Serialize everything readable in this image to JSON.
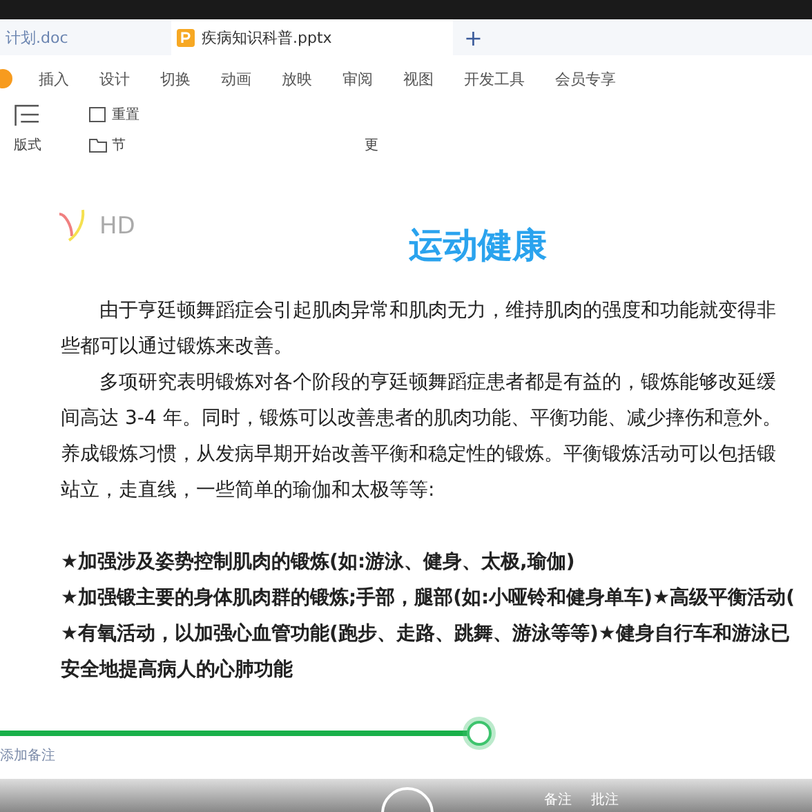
{
  "tabs": [
    {
      "label": "计划.doc",
      "kind": "doc",
      "selected": false
    },
    {
      "label": "疾病知识科普.pptx",
      "kind": "pptx",
      "selected": true
    }
  ],
  "new_tab": "+",
  "menu": [
    "插入",
    "设计",
    "切换",
    "动画",
    "放映",
    "审阅",
    "视图",
    "开发工具",
    "会员专享"
  ],
  "toolbar": {
    "reset": "重置",
    "layout": "版式",
    "section": "节",
    "more": "更"
  },
  "slide": {
    "logo_text": "HD",
    "title": "运动健康",
    "lines": [
      {
        "text": "由于亨廷顿舞蹈症会引起肌肉异常和肌肉无力，维持肌肉的强度和功能就变得非",
        "indent": true,
        "bold": false
      },
      {
        "text": "些都可以通过锻炼来改善。",
        "indent": false,
        "bold": false
      },
      {
        "text": "多项研究表明锻炼对各个阶段的亨廷顿舞蹈症患者都是有益的，锻炼能够改延缓",
        "indent": true,
        "bold": false
      },
      {
        "text": "间高达 3-4 年。同时，锻炼可以改善患者的肌肉功能、平衡功能、减少摔伤和意外。",
        "indent": false,
        "bold": false
      },
      {
        "text": "养成锻炼习惯，从发病早期开始改善平衡和稳定性的锻炼。平衡锻炼活动可以包括锻",
        "indent": false,
        "bold": false
      },
      {
        "text": "站立，走直线，一些简单的瑜伽和太极等等:",
        "indent": false,
        "bold": false
      },
      {
        "text": "★加强涉及姿势控制肌肉的锻炼(如:游泳、健身、太极,瑜伽)",
        "indent": false,
        "bold": true,
        "gap": true
      },
      {
        "text": "★加强锻主要的身体肌肉群的锻炼;手部，腿部(如:小哑铃和健身单车)★高级平衡活动(",
        "indent": false,
        "bold": true
      },
      {
        "text": "★有氧活动，以加强心血管功能(跑步、走路、跳舞、游泳等等)★健身自行车和游泳已",
        "indent": false,
        "bold": true
      },
      {
        "text": "安全地提高病人的心肺功能",
        "indent": false,
        "bold": true
      }
    ]
  },
  "progress": {
    "level": 0.59
  },
  "notes_placeholder": "添加备注",
  "status": [
    "备注",
    "批注"
  ]
}
